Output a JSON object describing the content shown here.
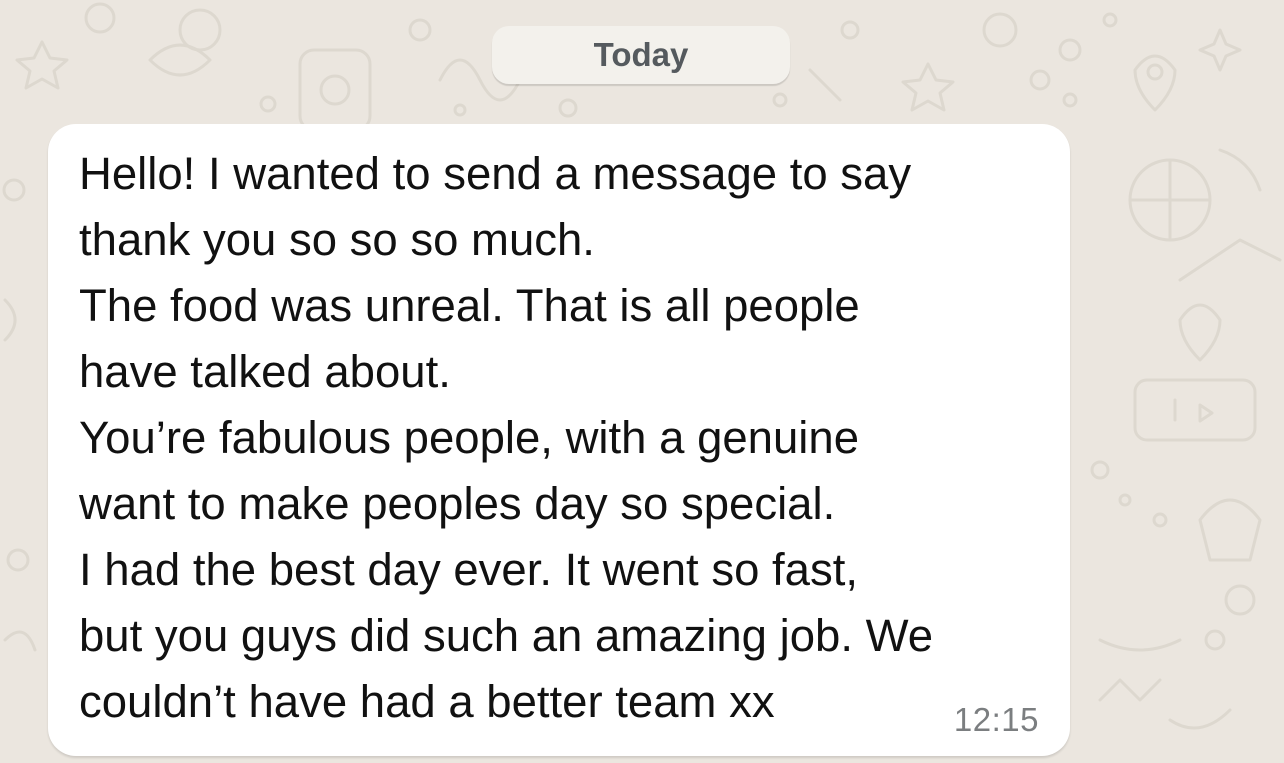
{
  "chat": {
    "date_separator": "Today",
    "message": {
      "lines": [
        "Hello! I wanted to send a message to say",
        "thank you so so so much.",
        "The food was unreal. That is all people",
        "have talked about.",
        "You’re fabulous people, with a genuine",
        "want to make peoples day so special.",
        "I had the best day ever. It went so fast,",
        "but you guys did such an amazing job. We",
        "couldn’t have had a better team xx"
      ],
      "time": "12:15"
    }
  },
  "colors": {
    "wallpaper": "#ebe6df",
    "bubble": "#ffffff",
    "date_pill": "#f3f1ec",
    "text": "#111111",
    "timestamp": "#7b7e80"
  }
}
